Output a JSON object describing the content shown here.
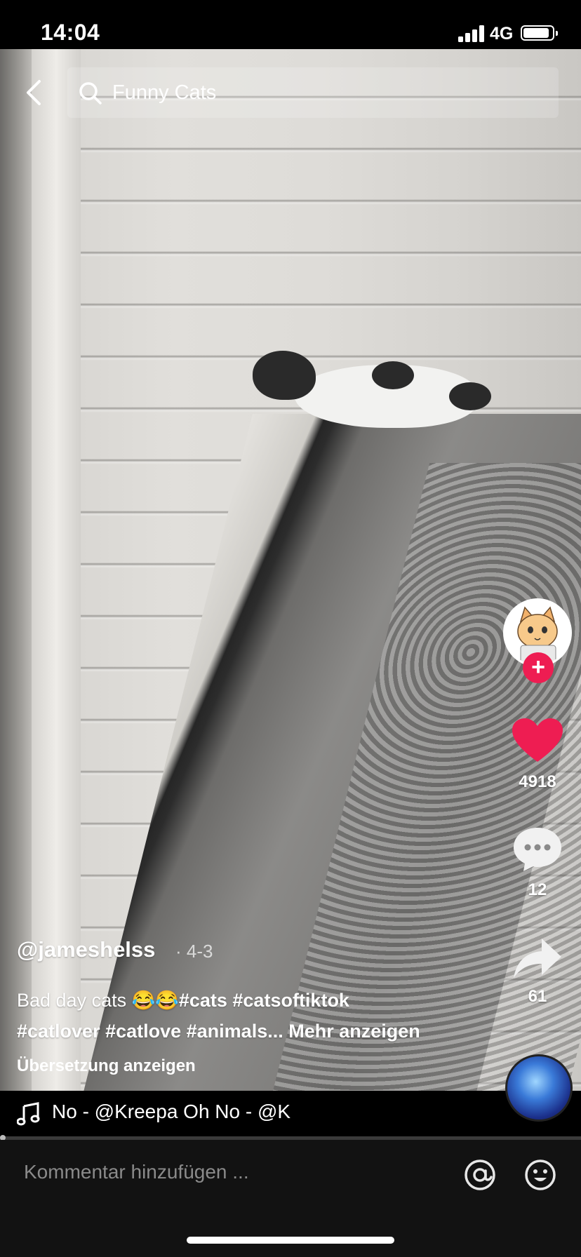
{
  "status_bar": {
    "time": "14:04",
    "network": "4G"
  },
  "search": {
    "query": "Funny Cats",
    "back_icon": "chevron-left-icon",
    "search_icon": "magnifier-icon"
  },
  "rail": {
    "follow_symbol": "+",
    "like_count": "4918",
    "comment_count": "12",
    "share_count": "61",
    "like_color": "#ee1d52"
  },
  "post": {
    "username": "@jameshelss",
    "date": "· 4-3",
    "caption_text": "Bad day cats 😂😂",
    "caption_tags_line1": "#cats #catsoftiktok",
    "caption_tags_line2": "#catlover #catlove #animals...",
    "more_label": "Mehr anzeigen",
    "translate_label": "Übersetzung anzeigen"
  },
  "music": {
    "track_text": "No - @Kreepa    Oh No - @K"
  },
  "comment_bar": {
    "placeholder": "Kommentar hinzufügen ...",
    "at_icon": "at-icon",
    "emoji_icon": "emoji-icon"
  }
}
